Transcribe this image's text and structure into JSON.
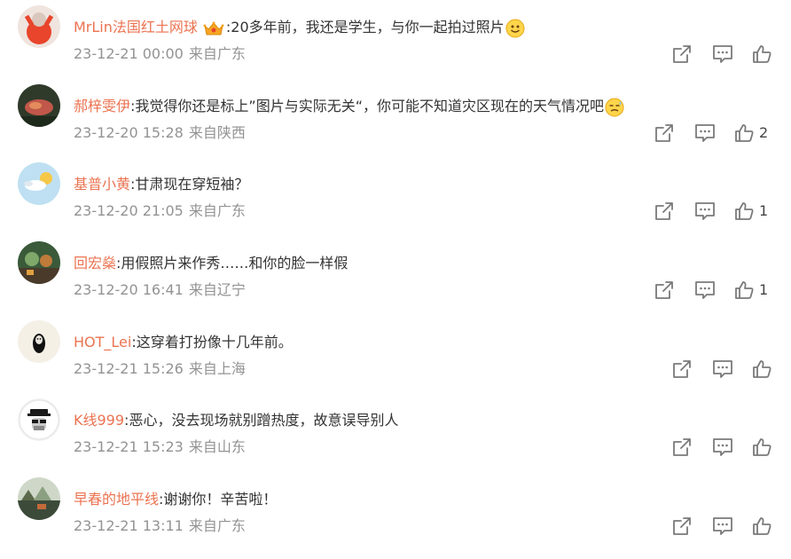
{
  "comments": [
    {
      "username": "MrLin法国红土网球",
      "has_badge": true,
      "text": "20多年前，我还是学生，与你一起拍过照片",
      "emoji": "smile-emoji",
      "timestamp": "23-12-21 00:00",
      "location": "来自广东",
      "likes": "",
      "avatar_colors": [
        "#f0e4df",
        "#e8452c"
      ]
    },
    {
      "username": "郝梓雯伊",
      "has_badge": false,
      "text": "我觉得你还是标上”图片与实际无关“，你可能不知道灾区现在的天气情况吧",
      "emoji": "sweat-emoji",
      "timestamp": "23-12-20 15:28",
      "location": "来自陕西",
      "likes": "2",
      "avatar_colors": [
        "#2f3a2a",
        "#c0574a"
      ]
    },
    {
      "username": "基普小黄",
      "has_badge": false,
      "text": "甘肃现在穿短袖？",
      "emoji": "",
      "timestamp": "23-12-20 21:05",
      "location": "来自广东",
      "likes": "1",
      "avatar_colors": [
        "#bfe0f2",
        "#ffffff"
      ]
    },
    {
      "username": "回宏燊",
      "has_badge": false,
      "text": "用假照片来作秀……和你的脸一样假",
      "emoji": "",
      "timestamp": "23-12-20 16:41",
      "location": "来自辽宁",
      "likes": "1",
      "avatar_colors": [
        "#3a5a3a",
        "#7fa86a"
      ]
    },
    {
      "username": "HOT_Lei",
      "has_badge": false,
      "text": "这穿着打扮像十几年前。",
      "emoji": "",
      "timestamp": "23-12-21 15:26",
      "location": "来自上海",
      "likes": "",
      "avatar_colors": [
        "#f4f0e6",
        "#111111"
      ]
    },
    {
      "username": "K线999",
      "has_badge": false,
      "text": "恶心，没去现场就别蹭热度，故意误导别人",
      "emoji": "",
      "timestamp": "23-12-21 15:23",
      "location": "来自山东",
      "likes": "",
      "avatar_colors": [
        "#ffffff",
        "#1a1a1a"
      ]
    },
    {
      "username": "早春的地平线",
      "has_badge": false,
      "text": "谢谢你！辛苦啦！",
      "emoji": "",
      "timestamp": "23-12-21 13:11",
      "location": "来自广东",
      "likes": "",
      "avatar_colors": [
        "#3c4a3a",
        "#8aa080"
      ]
    }
  ],
  "colors": {
    "username": "#eb7350",
    "text": "#333333",
    "meta": "#939393",
    "icon": "#7a7a7a"
  },
  "icons": {
    "share": "share-icon",
    "reply": "comment-icon",
    "like": "like-icon"
  }
}
